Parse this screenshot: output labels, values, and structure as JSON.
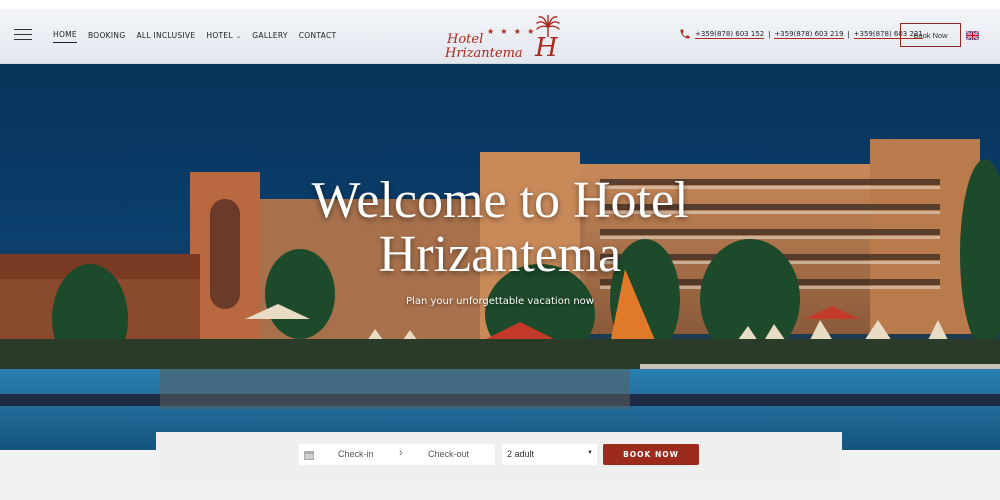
{
  "nav": {
    "items": [
      {
        "label": "HOME"
      },
      {
        "label": "BOOKING"
      },
      {
        "label": "ALL INCLUSIVE"
      },
      {
        "label": "HOTEL"
      },
      {
        "label": "GALLERY"
      },
      {
        "label": "CONTACT"
      }
    ]
  },
  "logo": {
    "line1": "Hotel",
    "line2": "Hrizantema",
    "stars": "★ ★ ★ ★",
    "mark": "H"
  },
  "contact": {
    "phones": [
      "+359(878) 603 152",
      "+359(878) 603 219",
      "+359(878) 603 221"
    ],
    "separator": "|"
  },
  "header": {
    "book_now_label": "Book Now"
  },
  "hero": {
    "title_line1": "Welcome to Hotel",
    "title_line2": "Hrizantema",
    "subtitle": "Plan your unforgettable vacation now"
  },
  "booking": {
    "checkin_label": "Check-in",
    "checkout_label": "Check-out",
    "guests_value": "2 adult",
    "submit_label": "BOOK NOW"
  },
  "colors": {
    "accent": "#9c2a1d",
    "sky": "#0b3f6d"
  }
}
